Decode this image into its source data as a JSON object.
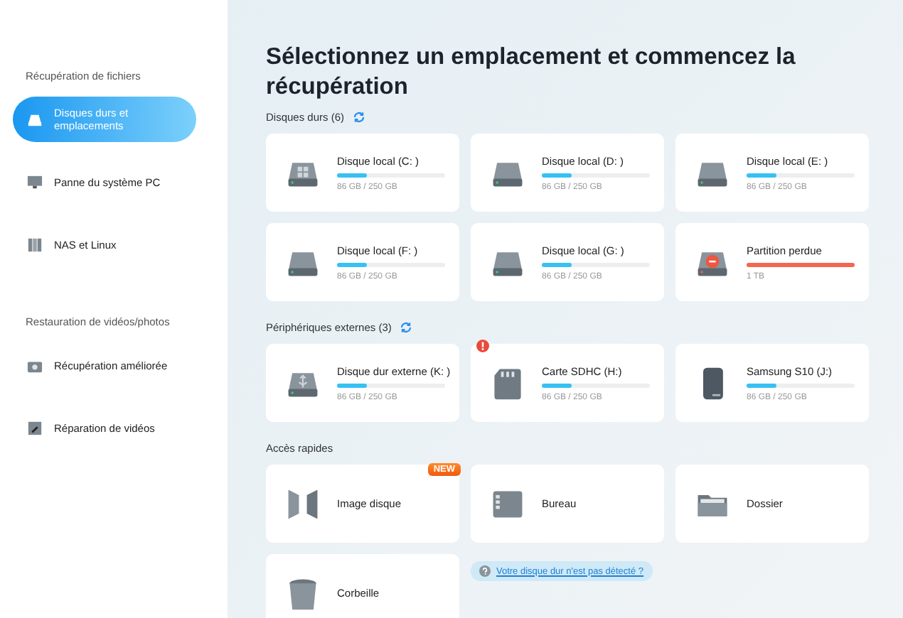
{
  "sidebar": {
    "sections": [
      {
        "heading": "Récupération de fichiers",
        "items": [
          {
            "label": "Disques durs et emplacements",
            "kind": "drive",
            "selected": true
          },
          {
            "label": "Panne du système PC",
            "kind": "monitor",
            "selected": false
          },
          {
            "label": "NAS et Linux",
            "kind": "nas",
            "selected": false
          }
        ]
      },
      {
        "heading": "Restauration de vidéos/photos",
        "items": [
          {
            "label": "Récupération améliorée",
            "kind": "camera",
            "selected": false
          },
          {
            "label": "Réparation de vidéos",
            "kind": "repair",
            "selected": false
          }
        ]
      }
    ]
  },
  "title": "Sélectionnez un emplacement et commencez la récupération",
  "hard_disks": {
    "heading": "Disques durs (6)",
    "drives": [
      {
        "name": "Disque local (C: )",
        "kind": "windows",
        "level": 0.28,
        "size": "86 GB / 250 GB"
      },
      {
        "name": "Disque local (D: )",
        "kind": "plain",
        "level": 0.28,
        "size": "86 GB / 250 GB"
      },
      {
        "name": "Disque local (E: )",
        "kind": "plain",
        "level": 0.28,
        "size": "86 GB / 250 GB"
      },
      {
        "name": "Disque local (F: )",
        "kind": "plain",
        "level": 0.28,
        "size": "86 GB / 250 GB"
      },
      {
        "name": "Disque local (G: )",
        "kind": "plain",
        "level": 0.28,
        "size": "86 GB / 250 GB"
      },
      {
        "name": "Partition perdue",
        "kind": "lost",
        "level": 1,
        "size": "1 TB"
      }
    ]
  },
  "external": {
    "heading": "Périphériques externes (3)",
    "drives": [
      {
        "name": "Disque dur externe (K: )",
        "kind": "usb",
        "level": 0.28,
        "size": "86 GB / 250 GB",
        "alert": false
      },
      {
        "name": "Carte SDHC (H:)",
        "kind": "sd",
        "level": 0.28,
        "size": "86 GB / 250 GB",
        "alert": true
      },
      {
        "name": "Samsung S10  (J:)",
        "kind": "phone",
        "level": 0.28,
        "size": "86 GB / 250 GB",
        "alert": false
      }
    ]
  },
  "quick_access": {
    "heading": "Accès rapides",
    "items": [
      {
        "label": "Image disque",
        "kind": "image",
        "badge": "NEW"
      },
      {
        "label": "Bureau",
        "kind": "desktop"
      },
      {
        "label": "Dossier",
        "kind": "folder"
      },
      {
        "label": "Corbeille",
        "kind": "trash"
      }
    ],
    "help_link": "Votre disque dur n'est pas détecté ?"
  }
}
